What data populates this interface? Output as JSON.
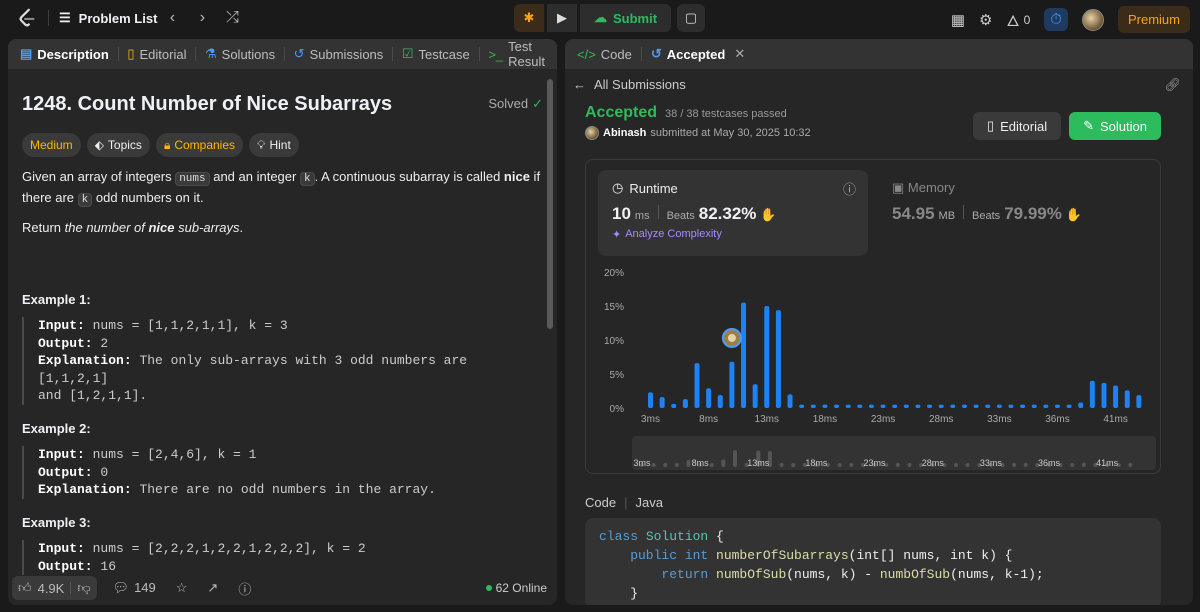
{
  "topbar": {
    "problem_list": "Problem List",
    "submit": "Submit",
    "streak": "0",
    "premium": "Premium"
  },
  "left_tabs": [
    {
      "label": "Description",
      "icon": "description-icon"
    },
    {
      "label": "Editorial",
      "icon": "book-icon"
    },
    {
      "label": "Solutions",
      "icon": "flask-icon"
    },
    {
      "label": "Submissions",
      "icon": "history-icon"
    },
    {
      "label": "Testcase",
      "icon": "checkbox-icon"
    },
    {
      "label": "Test Result",
      "icon": "terminal-icon"
    }
  ],
  "problem": {
    "title": "1248. Count Number of Nice Subarrays",
    "status": "Solved",
    "tags": {
      "difficulty": "Medium",
      "topics": "Topics",
      "companies": "Companies",
      "hint": "Hint"
    },
    "p1_a": "Given an array of integers ",
    "p1_code1": "nums",
    "p1_b": " and an integer ",
    "p1_code2": "k",
    "p1_c": ". A continuous subarray is called ",
    "p1_bold": "nice",
    "p1_d": " if there are ",
    "p1_code3": "k",
    "p1_e": " odd numbers on it.",
    "p2_a": "Return ",
    "p2_i1": "the number of ",
    "p2_bi": "nice",
    "p2_i2": " sub-arrays",
    "p2_b": ".",
    "examples": [
      {
        "title": "Example 1:",
        "input": "nums = [1,1,2,1,1], k = 3",
        "output": "2",
        "explanation": "The only sub-arrays with 3 odd numbers are [1,1,2,1]",
        "explanation2": "and [1,2,1,1]."
      },
      {
        "title": "Example 2:",
        "input": "nums = [2,4,6], k = 1",
        "output": "0",
        "explanation": "There are no odd numbers in the array.",
        "explanation2": ""
      },
      {
        "title": "Example 3:",
        "input": "nums = [2,2,2,1,2,2,1,2,2,2], k = 2",
        "output": "16",
        "explanation": "",
        "explanation2": ""
      }
    ],
    "labels": {
      "input": "Input:",
      "output": "Output:",
      "explanation": "Explanation:"
    }
  },
  "footer": {
    "likes": "4.9K",
    "comments": "149",
    "online": "62 Online"
  },
  "right_tabs": {
    "code": "Code",
    "accepted": "Accepted"
  },
  "submission": {
    "back": "All Submissions",
    "status": "Accepted",
    "testcases": "38 / 38 testcases passed",
    "user": "Abinash",
    "submitted": "submitted at May 30, 2025 10:32",
    "editorial_btn": "Editorial",
    "solution_btn": "Solution",
    "runtime_label": "Runtime",
    "runtime_value": "10",
    "runtime_unit": "ms",
    "beats_label": "Beats",
    "runtime_beats": "82.32%",
    "analyze": "Analyze Complexity",
    "memory_label": "Memory",
    "memory_value": "54.95",
    "memory_unit": "MB",
    "memory_beats": "79.99%"
  },
  "chart_data": {
    "type": "bar",
    "ylabel_ticks": [
      "20%",
      "15%",
      "10%",
      "5%",
      "0%"
    ],
    "xtick_labels": [
      "3ms",
      "8ms",
      "13ms",
      "18ms",
      "23ms",
      "28ms",
      "33ms",
      "36ms",
      "41ms"
    ],
    "minimap_labels": [
      "3ms",
      "8ms",
      "13ms",
      "18ms",
      "23ms",
      "28ms",
      "33ms",
      "36ms",
      "41ms"
    ],
    "ylim": [
      0,
      20
    ],
    "values": [
      2.3,
      1.6,
      0.6,
      1.3,
      6.6,
      2.9,
      1.9,
      6.8,
      15.5,
      3.5,
      15.0,
      14.4,
      2.0,
      0.5,
      0.5,
      0.5,
      0.5,
      0.5,
      0.5,
      0.5,
      0.5,
      0.5,
      0.5,
      0.5,
      0.5,
      0.5,
      0.5,
      0.5,
      0.5,
      0.5,
      0.5,
      0.5,
      0.5,
      0.5,
      0.5,
      0.5,
      0.5,
      0.8,
      4.0,
      3.7,
      3.3,
      2.6,
      1.9
    ],
    "highlight_index": 7,
    "color": "#1d82f5"
  },
  "code": {
    "header": "Code",
    "lang": "Java",
    "line1_kw": "class",
    "line1_cls": "Solution",
    "line1_rest": " {",
    "line2": "    public int ",
    "line2_fn": "numberOfSubarrays",
    "line2_rest": "(int[] nums, int k) {",
    "line3": "        return ",
    "line3_fn": "numbOfSub",
    "line3_mid": "(nums, k) - ",
    "line3_fn2": "numbOfSub",
    "line3_rest": "(nums, k-1);",
    "line4": "    }"
  }
}
